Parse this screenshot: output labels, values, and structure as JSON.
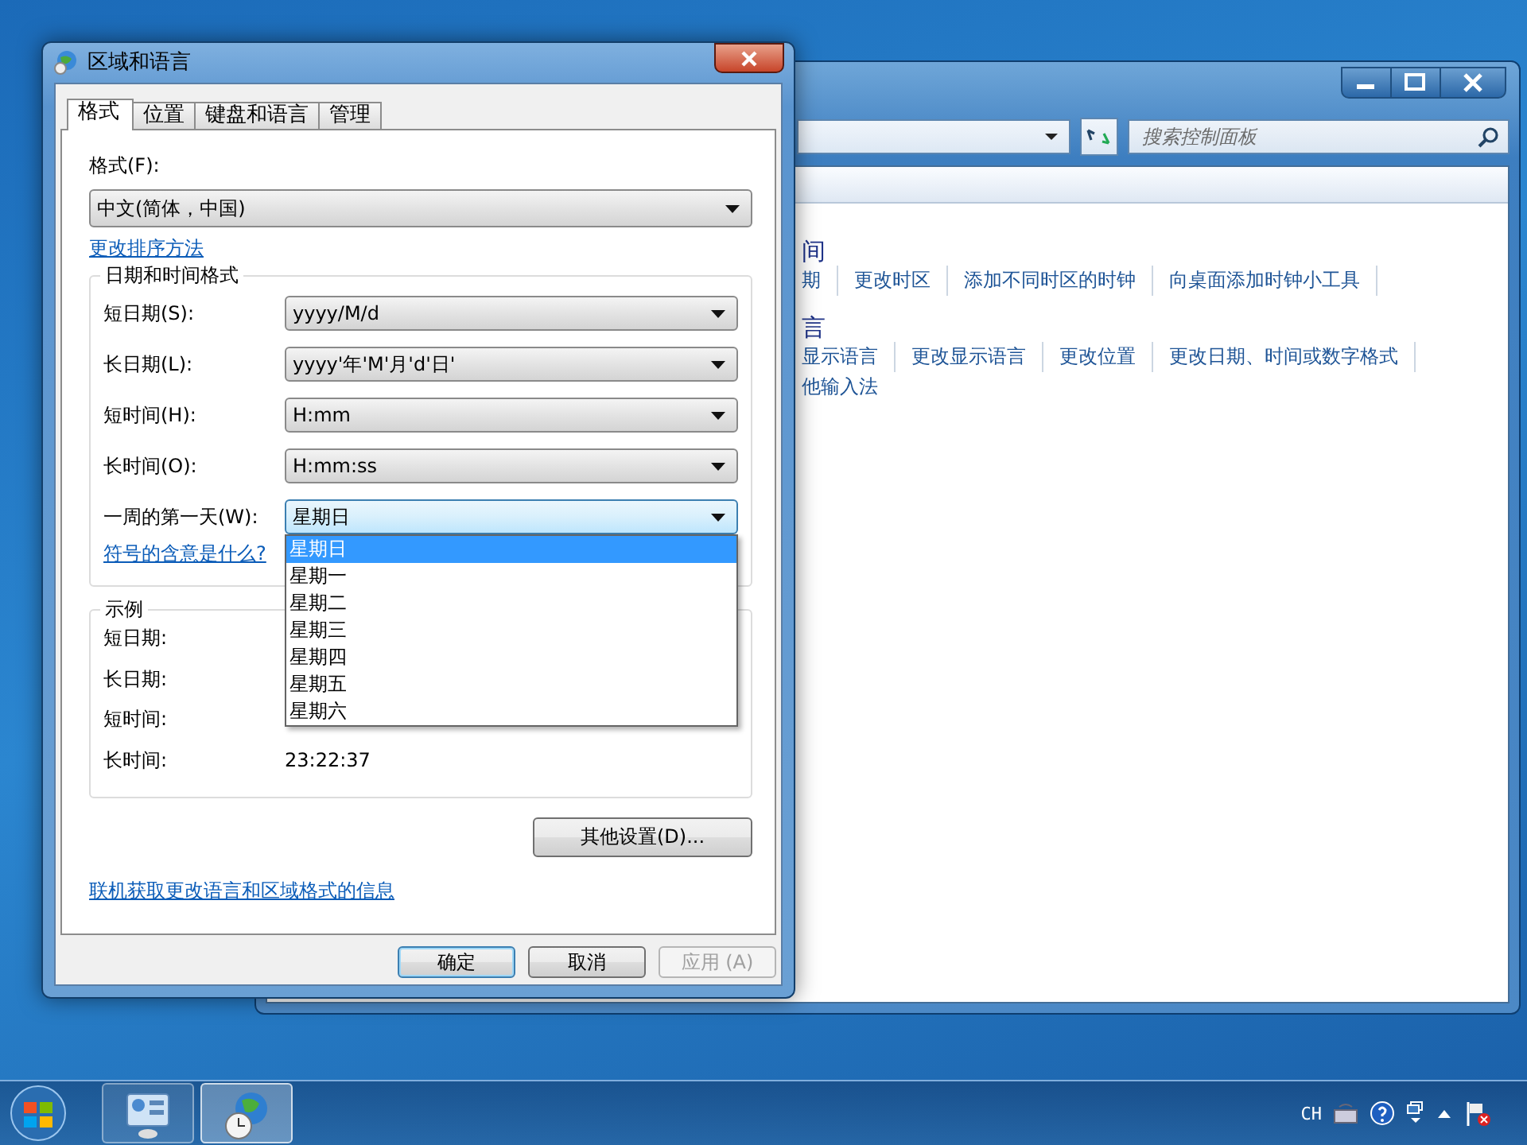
{
  "dialog": {
    "title": "区域和语言",
    "tabs": [
      {
        "label": "格式",
        "selected": true
      },
      {
        "label": "位置",
        "selected": false
      },
      {
        "label": "键盘和语言",
        "selected": false
      },
      {
        "label": "管理",
        "selected": false
      }
    ],
    "format_label": "格式(F):",
    "format_value": "中文(简体，中国)",
    "sort_link": "更改排序方法",
    "datetime_group": {
      "title": "日期和时间格式",
      "fields": [
        {
          "label": "短日期(S):",
          "value": "yyyy/M/d",
          "open": false
        },
        {
          "label": "长日期(L):",
          "value": "yyyy'年'M'月'd'日'",
          "open": false
        },
        {
          "label": "短时间(H):",
          "value": "H:mm",
          "open": false
        },
        {
          "label": "长时间(O):",
          "value": "H:mm:ss",
          "open": false
        },
        {
          "label": "一周的第一天(W):",
          "value": "星期日",
          "open": true
        }
      ]
    },
    "dropdown_list": [
      {
        "label": "星期日",
        "selected": true
      },
      {
        "label": "星期一",
        "selected": false
      },
      {
        "label": "星期二",
        "selected": false
      },
      {
        "label": "星期三",
        "selected": false
      },
      {
        "label": "星期四",
        "selected": false
      },
      {
        "label": "星期五",
        "selected": false
      },
      {
        "label": "星期六",
        "selected": false
      }
    ],
    "symbols_link": "符号的含意是什么?",
    "example_group": {
      "title": "示例",
      "rows": [
        {
          "label": "短日期:"
        },
        {
          "label": "长日期:"
        },
        {
          "label": "短时间:"
        },
        {
          "label": "长时间:",
          "value": "23:22:37"
        }
      ]
    },
    "more_button": "其他设置(D)...",
    "online_link": "联机获取更改语言和区域格式的信息",
    "buttons": [
      {
        "label": "确定",
        "kind": "default",
        "disabled": false
      },
      {
        "label": "取消",
        "kind": "normal",
        "disabled": false
      },
      {
        "label": "应用 (A)",
        "kind": "normal",
        "disabled": true
      }
    ]
  },
  "background_window": {
    "search_placeholder": "搜索控制面板",
    "sections": [
      {
        "heading": "间",
        "links": [
          "期",
          "更改时区",
          "添加不同时区的时钟",
          "向桌面添加时钟小工具"
        ]
      },
      {
        "heading": "言",
        "links": [
          "显示语言",
          "更改显示语言",
          "更改位置",
          "更改日期、时间或数字格式"
        ],
        "extra_links": [
          "他输入法"
        ]
      }
    ]
  },
  "taskbar": {
    "apps": [
      {
        "kind": "control-panel",
        "active": false
      },
      {
        "kind": "region-clock",
        "active": true
      }
    ],
    "tray": {
      "language": "CH"
    }
  }
}
